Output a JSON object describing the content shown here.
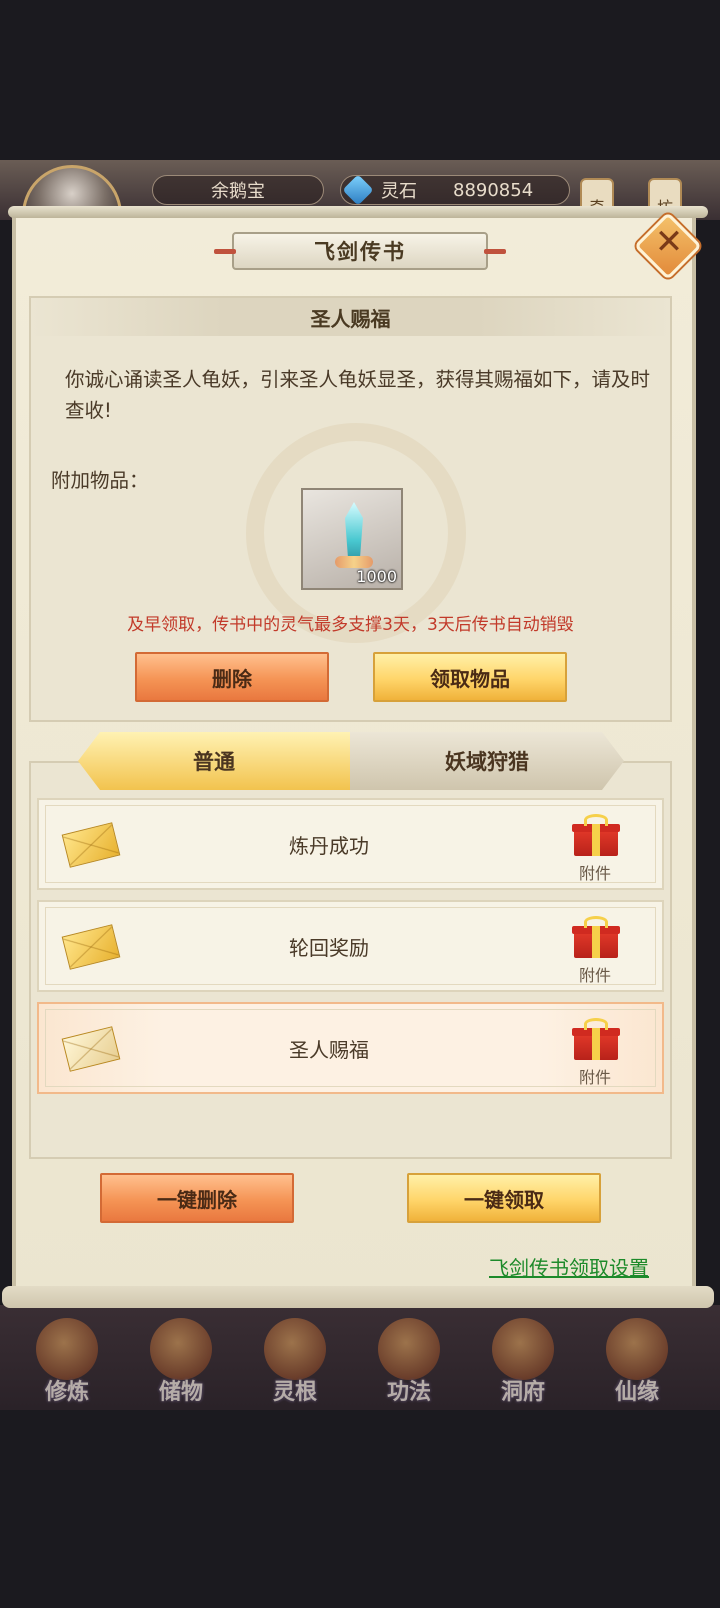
{
  "hud": {
    "player_name": "余鹅宝",
    "currency_label": "灵石",
    "currency_value": "8890854",
    "side_tags": [
      "奇",
      "坊"
    ]
  },
  "panel": {
    "title": "飞剑传书",
    "close_icon": "close-icon"
  },
  "detail": {
    "header": "圣人赐福",
    "body": "你诚心诵读圣人龟妖，引来圣人龟妖显圣，获得其赐福如下，请及时查收!",
    "attach_label": "附加物品：",
    "item": {
      "icon": "sword-icon",
      "count": "1000"
    },
    "warning": "及早领取，传书中的灵气最多支撑3天，3天后传书自动销毁",
    "delete_label": "删除",
    "claim_label": "领取物品"
  },
  "tabs": [
    {
      "label": "普通",
      "active": true
    },
    {
      "label": "妖域狩猎",
      "active": false
    }
  ],
  "mails": [
    {
      "title": "炼丹成功",
      "attachment": "附件",
      "opened": false
    },
    {
      "title": "轮回奖励",
      "attachment": "附件",
      "opened": false
    },
    {
      "title": "圣人赐福",
      "attachment": "附件",
      "opened": true
    }
  ],
  "actions": {
    "delete_all": "一键删除",
    "claim_all": "一键领取",
    "settings_link": "飞剑传书领取设置"
  },
  "bottom_nav": [
    "修炼",
    "储物",
    "灵根",
    "功法",
    "洞府",
    "仙缘"
  ],
  "colors": {
    "accent_orange": "#f59455",
    "accent_yellow": "#ffd56a",
    "warning_red": "#c23a2a",
    "link_green": "#1d8a2a"
  }
}
